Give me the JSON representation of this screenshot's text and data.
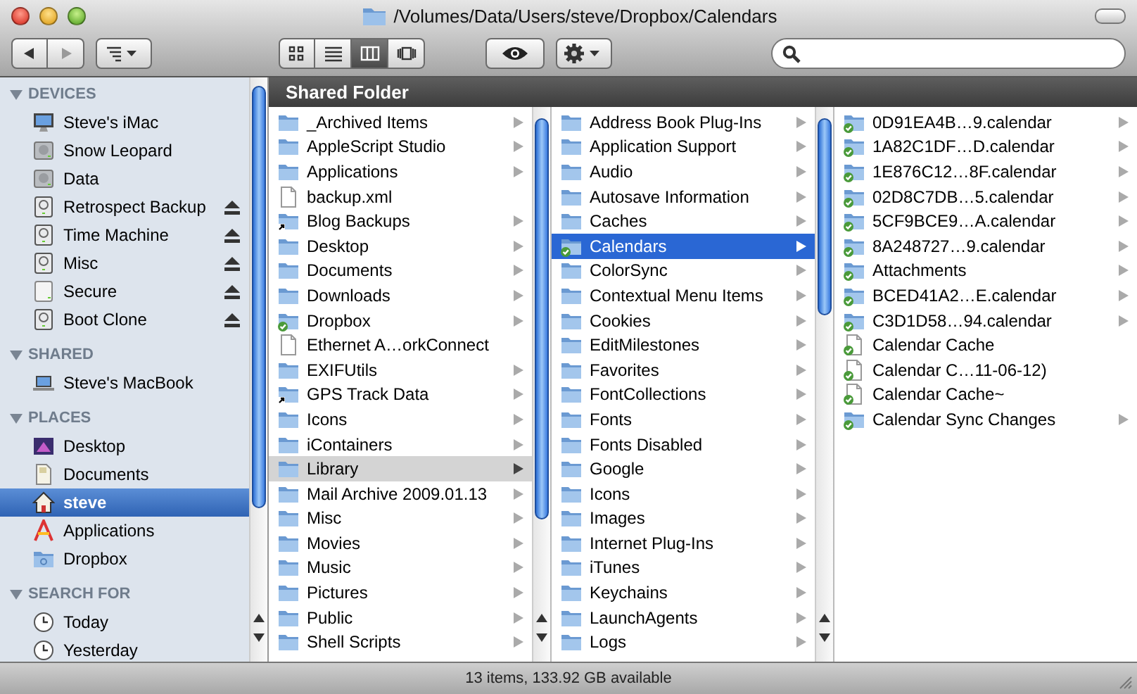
{
  "window": {
    "title": "/Volumes/Data/Users/steve/Dropbox/Calendars"
  },
  "toolbar": {
    "view_modes": [
      {
        "kind": "icons",
        "selected": false
      },
      {
        "kind": "list",
        "selected": false
      },
      {
        "kind": "columns",
        "selected": true
      },
      {
        "kind": "coverflow",
        "selected": false
      }
    ]
  },
  "sidebar": {
    "sections": [
      {
        "heading": "DEVICES",
        "expanded": true,
        "items": [
          {
            "label": "Steve's iMac",
            "kind": "monitor",
            "eject": false,
            "selected": false
          },
          {
            "label": "Snow Leopard",
            "kind": "hard-drive",
            "eject": false,
            "selected": false
          },
          {
            "label": "Data",
            "kind": "hard-drive",
            "eject": false,
            "selected": false
          },
          {
            "label": "Retrospect Backup",
            "kind": "external-drive",
            "eject": true,
            "selected": false
          },
          {
            "label": "Time Machine",
            "kind": "external-drive",
            "eject": true,
            "selected": false
          },
          {
            "label": "Misc",
            "kind": "external-drive",
            "eject": true,
            "selected": false
          },
          {
            "label": "Secure",
            "kind": "drive",
            "eject": true,
            "selected": false
          },
          {
            "label": "Boot Clone",
            "kind": "external-drive",
            "eject": true,
            "selected": false
          }
        ]
      },
      {
        "heading": "SHARED",
        "expanded": true,
        "items": [
          {
            "label": "Steve's MacBook",
            "kind": "laptop",
            "eject": false,
            "selected": false
          }
        ]
      },
      {
        "heading": "PLACES",
        "expanded": true,
        "items": [
          {
            "label": "Desktop",
            "kind": "desktop",
            "eject": false,
            "selected": false
          },
          {
            "label": "Documents",
            "kind": "document",
            "eject": false,
            "selected": false
          },
          {
            "label": "steve",
            "kind": "house",
            "eject": false,
            "selected": true
          },
          {
            "label": "Applications",
            "kind": "applications",
            "eject": false,
            "selected": false
          },
          {
            "label": "Dropbox",
            "kind": "folder",
            "eject": false,
            "selected": false
          }
        ]
      },
      {
        "heading": "SEARCH FOR",
        "expanded": true,
        "items": [
          {
            "label": "Today",
            "kind": "clock",
            "eject": false,
            "selected": false
          },
          {
            "label": "Yesterday",
            "kind": "clock",
            "eject": false,
            "selected": false
          }
        ]
      }
    ]
  },
  "path_header": "Shared Folder",
  "columns": [
    {
      "focused": false,
      "items": [
        {
          "label": "_Archived Items",
          "kind": "folder",
          "synced": false,
          "alias": false,
          "has_children": true,
          "selected": false
        },
        {
          "label": "AppleScript Studio",
          "kind": "folder",
          "synced": false,
          "alias": false,
          "has_children": true,
          "selected": false
        },
        {
          "label": "Applications",
          "kind": "folder",
          "synced": false,
          "alias": false,
          "has_children": true,
          "selected": false
        },
        {
          "label": "backup.xml",
          "kind": "document",
          "synced": false,
          "alias": false,
          "has_children": false,
          "selected": false
        },
        {
          "label": "Blog Backups",
          "kind": "folder",
          "synced": false,
          "alias": true,
          "has_children": true,
          "selected": false
        },
        {
          "label": "Desktop",
          "kind": "folder",
          "synced": false,
          "alias": false,
          "has_children": true,
          "selected": false
        },
        {
          "label": "Documents",
          "kind": "folder",
          "synced": false,
          "alias": false,
          "has_children": true,
          "selected": false
        },
        {
          "label": "Downloads",
          "kind": "folder",
          "synced": false,
          "alias": false,
          "has_children": true,
          "selected": false
        },
        {
          "label": "Dropbox",
          "kind": "folder",
          "synced": true,
          "alias": false,
          "has_children": true,
          "selected": false
        },
        {
          "label": "Ethernet A…orkConnect",
          "kind": "document",
          "synced": false,
          "alias": false,
          "has_children": false,
          "selected": false
        },
        {
          "label": "EXIFUtils",
          "kind": "folder",
          "synced": false,
          "alias": false,
          "has_children": true,
          "selected": false
        },
        {
          "label": "GPS Track Data",
          "kind": "folder",
          "synced": false,
          "alias": true,
          "has_children": true,
          "selected": false
        },
        {
          "label": "Icons",
          "kind": "folder",
          "synced": false,
          "alias": false,
          "has_children": true,
          "selected": false
        },
        {
          "label": "iContainers",
          "kind": "folder",
          "synced": false,
          "alias": false,
          "has_children": true,
          "selected": false
        },
        {
          "label": "Library",
          "kind": "folder",
          "synced": false,
          "alias": false,
          "has_children": true,
          "selected": true
        },
        {
          "label": "Mail Archive 2009.01.13",
          "kind": "folder",
          "synced": false,
          "alias": false,
          "has_children": true,
          "selected": false
        },
        {
          "label": "Misc",
          "kind": "folder",
          "synced": false,
          "alias": false,
          "has_children": true,
          "selected": false
        },
        {
          "label": "Movies",
          "kind": "folder",
          "synced": false,
          "alias": false,
          "has_children": true,
          "selected": false
        },
        {
          "label": "Music",
          "kind": "folder",
          "synced": false,
          "alias": false,
          "has_children": true,
          "selected": false
        },
        {
          "label": "Pictures",
          "kind": "folder",
          "synced": false,
          "alias": false,
          "has_children": true,
          "selected": false
        },
        {
          "label": "Public",
          "kind": "folder",
          "synced": false,
          "alias": false,
          "has_children": true,
          "selected": false
        },
        {
          "label": "Shell Scripts",
          "kind": "folder",
          "synced": false,
          "alias": false,
          "has_children": true,
          "selected": false
        }
      ]
    },
    {
      "focused": true,
      "items": [
        {
          "label": "Address Book Plug-Ins",
          "kind": "folder",
          "synced": false,
          "alias": false,
          "has_children": true,
          "selected": false
        },
        {
          "label": "Application Support",
          "kind": "folder",
          "synced": false,
          "alias": false,
          "has_children": true,
          "selected": false
        },
        {
          "label": "Audio",
          "kind": "folder",
          "synced": false,
          "alias": false,
          "has_children": true,
          "selected": false
        },
        {
          "label": "Autosave Information",
          "kind": "folder",
          "synced": false,
          "alias": false,
          "has_children": true,
          "selected": false
        },
        {
          "label": "Caches",
          "kind": "folder",
          "synced": false,
          "alias": false,
          "has_children": true,
          "selected": false
        },
        {
          "label": "Calendars",
          "kind": "folder",
          "synced": true,
          "alias": false,
          "has_children": true,
          "selected": true
        },
        {
          "label": "ColorSync",
          "kind": "folder",
          "synced": false,
          "alias": false,
          "has_children": true,
          "selected": false
        },
        {
          "label": "Contextual Menu Items",
          "kind": "folder",
          "synced": false,
          "alias": false,
          "has_children": true,
          "selected": false
        },
        {
          "label": "Cookies",
          "kind": "folder",
          "synced": false,
          "alias": false,
          "has_children": true,
          "selected": false
        },
        {
          "label": "EditMilestones",
          "kind": "folder",
          "synced": false,
          "alias": false,
          "has_children": true,
          "selected": false
        },
        {
          "label": "Favorites",
          "kind": "folder",
          "synced": false,
          "alias": false,
          "has_children": true,
          "selected": false
        },
        {
          "label": "FontCollections",
          "kind": "folder",
          "synced": false,
          "alias": false,
          "has_children": true,
          "selected": false
        },
        {
          "label": "Fonts",
          "kind": "folder",
          "synced": false,
          "alias": false,
          "has_children": true,
          "selected": false
        },
        {
          "label": "Fonts Disabled",
          "kind": "folder",
          "synced": false,
          "alias": false,
          "has_children": true,
          "selected": false
        },
        {
          "label": "Google",
          "kind": "folder",
          "synced": false,
          "alias": false,
          "has_children": true,
          "selected": false
        },
        {
          "label": "Icons",
          "kind": "folder",
          "synced": false,
          "alias": false,
          "has_children": true,
          "selected": false
        },
        {
          "label": "Images",
          "kind": "folder",
          "synced": false,
          "alias": false,
          "has_children": true,
          "selected": false
        },
        {
          "label": "Internet Plug-Ins",
          "kind": "folder",
          "synced": false,
          "alias": false,
          "has_children": true,
          "selected": false
        },
        {
          "label": "iTunes",
          "kind": "folder",
          "synced": false,
          "alias": false,
          "has_children": true,
          "selected": false
        },
        {
          "label": "Keychains",
          "kind": "folder",
          "synced": false,
          "alias": false,
          "has_children": true,
          "selected": false
        },
        {
          "label": "LaunchAgents",
          "kind": "folder",
          "synced": false,
          "alias": false,
          "has_children": true,
          "selected": false
        },
        {
          "label": "Logs",
          "kind": "folder",
          "synced": false,
          "alias": false,
          "has_children": true,
          "selected": false
        }
      ]
    },
    {
      "items": [
        {
          "label": "0D91EA4B…9.calendar",
          "kind": "folder",
          "synced": true,
          "alias": false,
          "has_children": true,
          "selected": false
        },
        {
          "label": "1A82C1DF…D.calendar",
          "kind": "folder",
          "synced": true,
          "alias": false,
          "has_children": true,
          "selected": false
        },
        {
          "label": "1E876C12…8F.calendar",
          "kind": "folder",
          "synced": true,
          "alias": false,
          "has_children": true,
          "selected": false
        },
        {
          "label": "02D8C7DB…5.calendar",
          "kind": "folder",
          "synced": true,
          "alias": false,
          "has_children": true,
          "selected": false
        },
        {
          "label": "5CF9BCE9…A.calendar",
          "kind": "folder",
          "synced": true,
          "alias": false,
          "has_children": true,
          "selected": false
        },
        {
          "label": "8A248727…9.calendar",
          "kind": "folder",
          "synced": true,
          "alias": false,
          "has_children": true,
          "selected": false
        },
        {
          "label": "Attachments",
          "kind": "folder",
          "synced": true,
          "alias": false,
          "has_children": true,
          "selected": false
        },
        {
          "label": "BCED41A2…E.calendar",
          "kind": "folder",
          "synced": true,
          "alias": false,
          "has_children": true,
          "selected": false
        },
        {
          "label": "C3D1D58…94.calendar",
          "kind": "folder",
          "synced": true,
          "alias": false,
          "has_children": true,
          "selected": false
        },
        {
          "label": "Calendar Cache",
          "kind": "document",
          "synced": true,
          "alias": false,
          "has_children": false,
          "selected": false
        },
        {
          "label": "Calendar C…11-06-12)",
          "kind": "document",
          "synced": true,
          "alias": false,
          "has_children": false,
          "selected": false
        },
        {
          "label": "Calendar Cache~",
          "kind": "document",
          "synced": true,
          "alias": false,
          "has_children": false,
          "selected": false
        },
        {
          "label": "Calendar Sync Changes",
          "kind": "folder",
          "synced": true,
          "alias": false,
          "has_children": true,
          "selected": false
        }
      ]
    }
  ],
  "status_bar": "13 items, 133.92 GB available"
}
